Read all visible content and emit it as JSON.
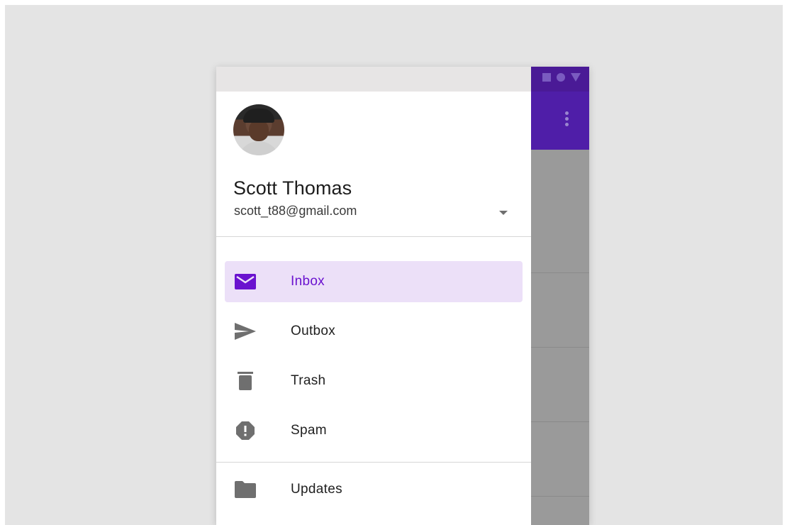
{
  "colors": {
    "accent": "#6a12cf",
    "active_background": "#ece0f8",
    "app_bar": "#4f1ea8",
    "status_bar": "#4a1a96",
    "icon_gray": "#6f6f6f"
  },
  "account": {
    "name": "Scott Thomas",
    "email": "scott_t88@gmail.com",
    "toggle_icon": "arrow-drop-down-icon"
  },
  "nav": {
    "primary": [
      {
        "label": "Inbox",
        "icon": "mail-icon",
        "active": true
      },
      {
        "label": "Outbox",
        "icon": "send-icon",
        "active": false
      },
      {
        "label": "Trash",
        "icon": "trash-icon",
        "active": false
      },
      {
        "label": "Spam",
        "icon": "report-icon",
        "active": false
      }
    ],
    "secondary": [
      {
        "label": "Updates",
        "icon": "folder-icon",
        "active": false
      }
    ]
  }
}
